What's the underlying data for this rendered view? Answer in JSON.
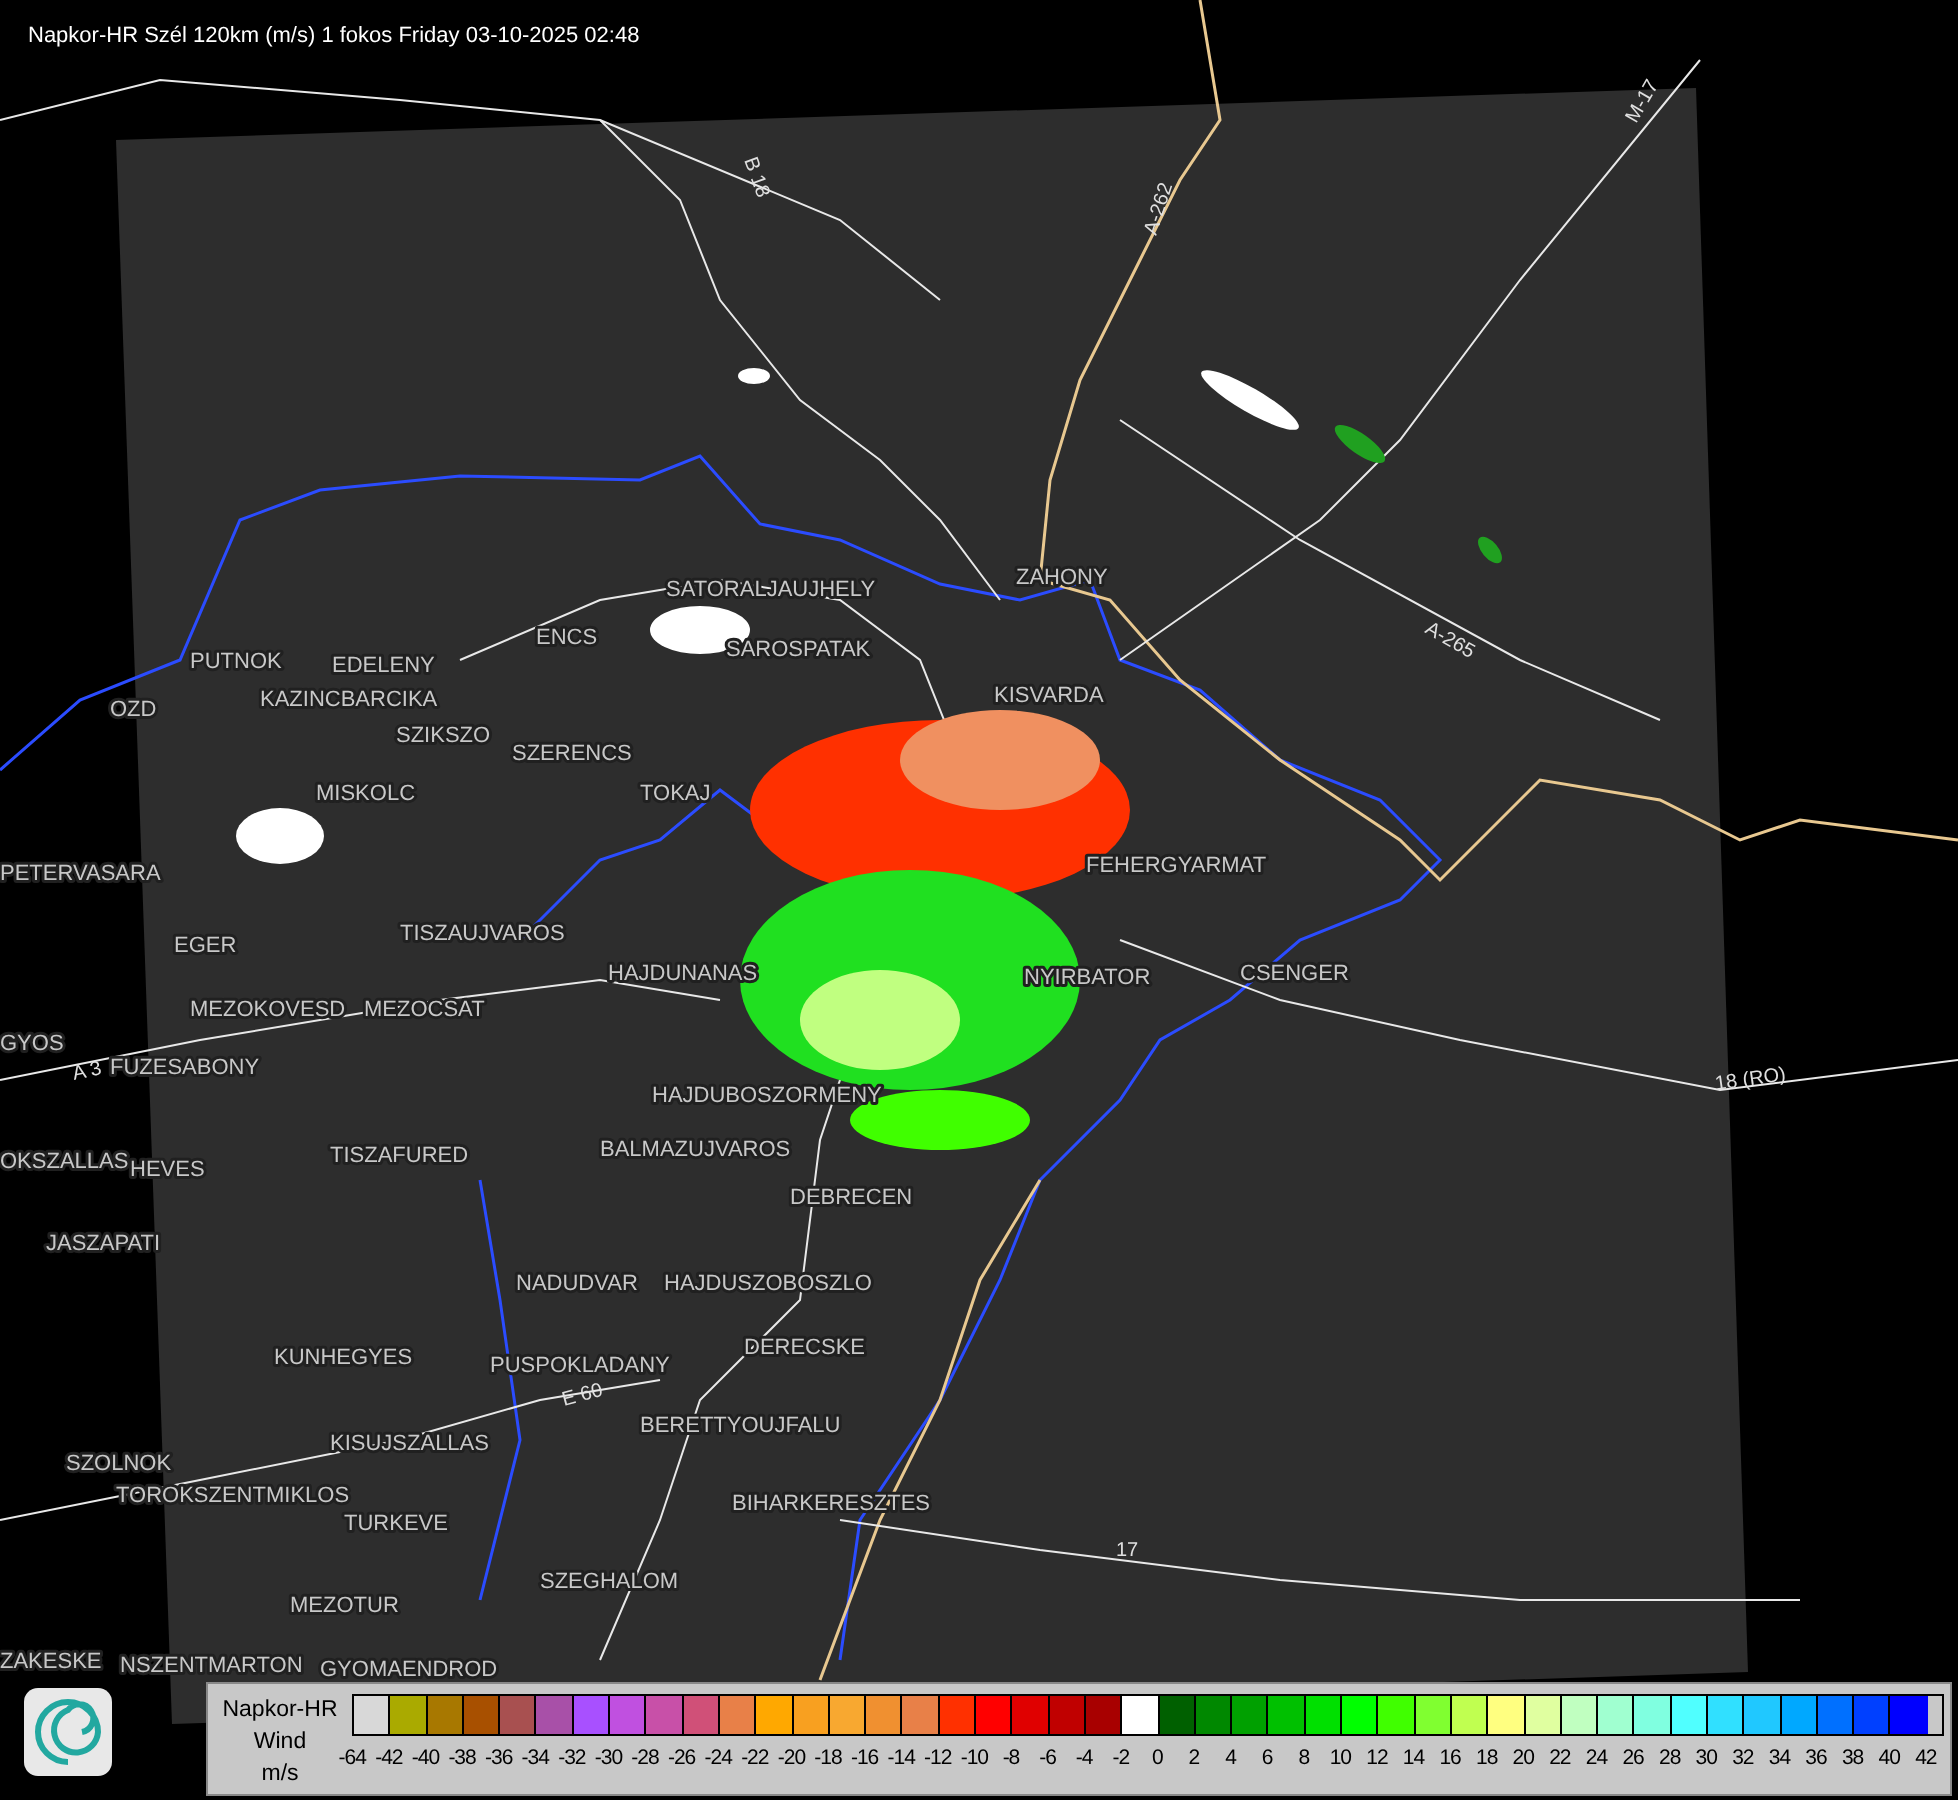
{
  "title": "Napkor-HR Szél 120km (m/s) 1 fokos Friday 03-10-2025 02:48",
  "map": {
    "places": [
      "SATORALJAUJHELY",
      "ZAHONY",
      "PUTNOK",
      "EDELENY",
      "SAROSPATAK",
      "ENCS",
      "KAZINCBARCIKA",
      "KISVARDA",
      "SZIKSZO",
      "SZERENCS",
      "OZD",
      "MISKOLC",
      "TOKAJ",
      "PETERVASARA",
      "FEHERGYARMAT",
      "EGER",
      "TISZAUJVAROS",
      "HAJDUNANAS",
      "NYIRBATOR",
      "CSENGER",
      "MEZOKOVESD",
      "MEZOCSAT",
      "GYOS",
      "FUZESABONY",
      "HAJDUBOSZORMENY",
      "TISZAFURED",
      "BALMAZUJVAROS",
      "HEVES",
      "OKSZALLAS",
      "DEBRECEN",
      "JASZAPATI",
      "NADUDVAR",
      "HAJDUSZOBOSZLO",
      "KUNHEGYES",
      "PUSPOKLADANY",
      "DERECSKE",
      "BERETTYOUJFALU",
      "KISUJSZALLAS",
      "SZOLNOK",
      "TOROKSZENTMIKLOS",
      "BIHARKERESZTES",
      "TURKEVE",
      "SZEGHALOM",
      "MEZOTUR",
      "ZAKESKE",
      "NSZENTMARTON",
      "GYOMAENDROD"
    ],
    "roads": [
      "B 18",
      "A-262",
      "M-17",
      "A-265",
      "18 (RO)",
      "17",
      "A 3",
      "E 60"
    ]
  },
  "legend": {
    "title": "Napkor-HR",
    "subtitle": "Wind",
    "unit": "m/s",
    "bins": [
      {
        "color": "#d8d8d8"
      },
      {
        "color": "#aaaa00"
      },
      {
        "color": "#a87800"
      },
      {
        "color": "#a85000"
      },
      {
        "color": "#a85050"
      },
      {
        "color": "#a850a8"
      },
      {
        "color": "#a850ff"
      },
      {
        "color": "#c050e0"
      },
      {
        "color": "#c850a8"
      },
      {
        "color": "#d05078"
      },
      {
        "color": "#e88048"
      },
      {
        "color": "#ffa800"
      },
      {
        "color": "#f8a020"
      },
      {
        "color": "#f8a830"
      },
      {
        "color": "#f09030"
      },
      {
        "color": "#e88048"
      },
      {
        "color": "#ff3000"
      },
      {
        "color": "#ff0000"
      },
      {
        "color": "#e00000"
      },
      {
        "color": "#c00000"
      },
      {
        "color": "#a80000"
      },
      {
        "color": "#ffffff"
      },
      {
        "color": "#006000"
      },
      {
        "color": "#008800"
      },
      {
        "color": "#00a000"
      },
      {
        "color": "#00c000"
      },
      {
        "color": "#00e000"
      },
      {
        "color": "#00ff00"
      },
      {
        "color": "#40ff00"
      },
      {
        "color": "#80ff30"
      },
      {
        "color": "#c0ff50"
      },
      {
        "color": "#ffff80"
      },
      {
        "color": "#e0ffa0"
      },
      {
        "color": "#c0ffc0"
      },
      {
        "color": "#a0ffd0"
      },
      {
        "color": "#80ffe0"
      },
      {
        "color": "#50ffff"
      },
      {
        "color": "#30e0ff"
      },
      {
        "color": "#20c8ff"
      },
      {
        "color": "#00a8ff"
      },
      {
        "color": "#0070ff"
      },
      {
        "color": "#0040ff"
      },
      {
        "color": "#0000ff"
      }
    ],
    "ticks": [
      "-64",
      "-42",
      "-40",
      "-38",
      "-36",
      "-34",
      "-32",
      "-30",
      "-28",
      "-26",
      "-24",
      "-22",
      "-20",
      "-18",
      "-16",
      "-14",
      "-12",
      "-10",
      "-8",
      "-6",
      "-4",
      "-2",
      "0",
      "2",
      "4",
      "6",
      "8",
      "10",
      "12",
      "14",
      "16",
      "18",
      "20",
      "22",
      "24",
      "26",
      "28",
      "30",
      "32",
      "34",
      "36",
      "38",
      "40",
      "42"
    ]
  }
}
